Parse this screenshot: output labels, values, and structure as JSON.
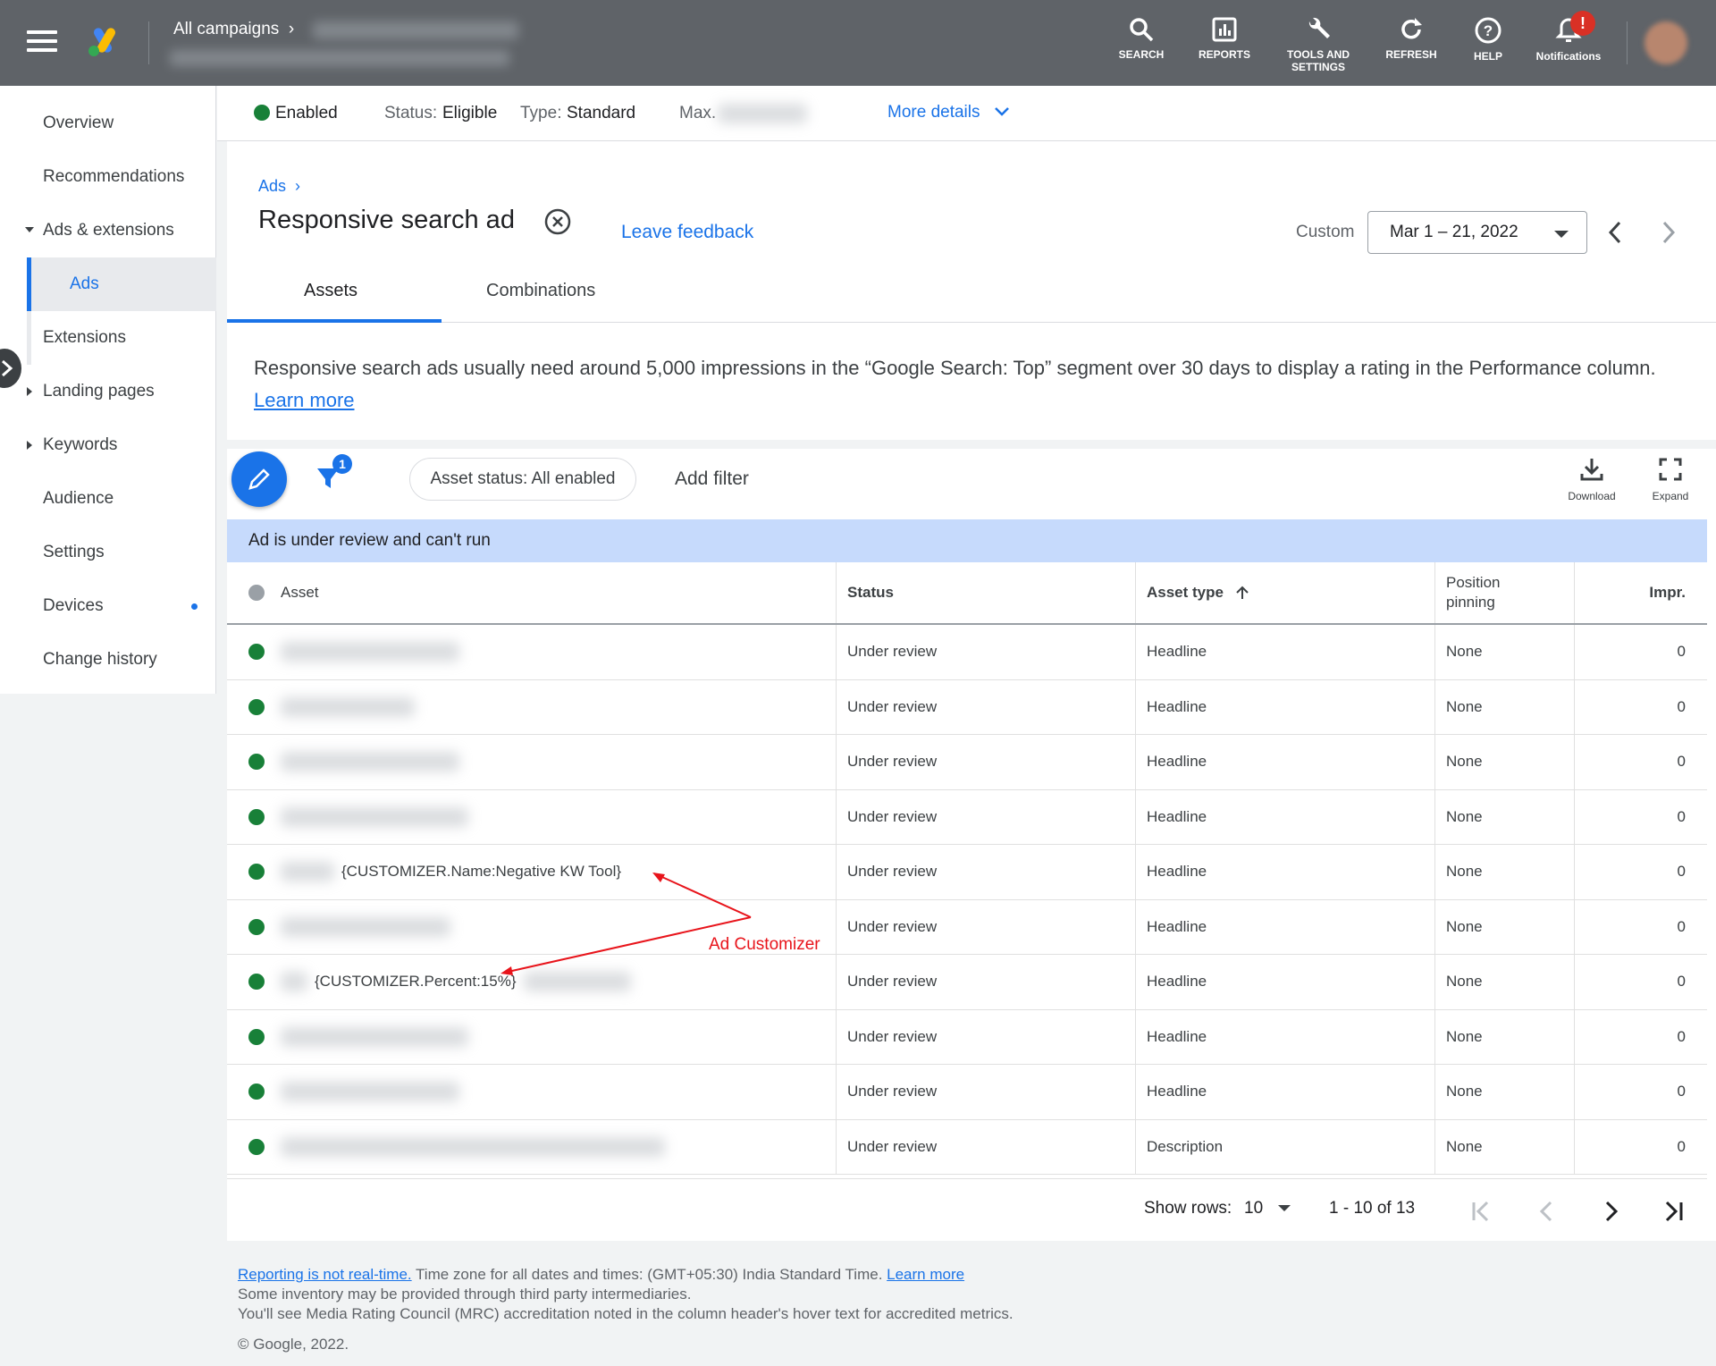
{
  "topbar": {
    "breadcrumb": "All campaigns",
    "items": [
      {
        "label": "SEARCH",
        "icon": "search-icon"
      },
      {
        "label": "REPORTS",
        "icon": "reports-icon"
      },
      {
        "label": "TOOLS AND SETTINGS",
        "icon": "wrench-icon"
      },
      {
        "label": "REFRESH",
        "icon": "refresh-icon"
      },
      {
        "label": "HELP",
        "icon": "help-icon"
      },
      {
        "label": "Notifications",
        "icon": "bell-icon"
      }
    ],
    "notification_badge": "!"
  },
  "sidebar": {
    "items": [
      {
        "label": "Overview"
      },
      {
        "label": "Recommendations"
      },
      {
        "label": "Ads & extensions"
      },
      {
        "label": "Ads"
      },
      {
        "label": "Extensions"
      },
      {
        "label": "Landing pages"
      },
      {
        "label": "Keywords"
      },
      {
        "label": "Audience"
      },
      {
        "label": "Settings"
      },
      {
        "label": "Devices"
      },
      {
        "label": "Change history"
      }
    ]
  },
  "statusbar": {
    "enabled": "Enabled",
    "status_label": "Status:",
    "status_value": "Eligible",
    "type_label": "Type:",
    "type_value": "Standard",
    "max_label": "Max.",
    "more_details": "More details"
  },
  "header": {
    "breadcrumb": "Ads",
    "title": "Responsive search ad",
    "feedback": "Leave feedback",
    "date_label": "Custom",
    "date_range": "Mar 1 – 21, 2022",
    "tabs": [
      "Assets",
      "Combinations"
    ]
  },
  "notice": {
    "text": "Responsive search ads usually need around 5,000 impressions in the “Google Search: Top” segment over 30 days to display a rating in the Performance column.",
    "link": "Learn more"
  },
  "toolbar": {
    "filter_count": "1",
    "chip": "Asset status: All enabled",
    "add_filter": "Add filter",
    "download": "Download",
    "expand": "Expand"
  },
  "review_bar": "Ad is under review and can't run",
  "table": {
    "columns": [
      "Asset",
      "Status",
      "Asset type",
      "Position pinning",
      "Impr."
    ],
    "rows": [
      {
        "asset": "",
        "status": "Under review",
        "type": "Headline",
        "pinning": "None",
        "impr": "0"
      },
      {
        "asset": "",
        "status": "Under review",
        "type": "Headline",
        "pinning": "None",
        "impr": "0"
      },
      {
        "asset": "",
        "status": "Under review",
        "type": "Headline",
        "pinning": "None",
        "impr": "0"
      },
      {
        "asset": "",
        "status": "Under review",
        "type": "Headline",
        "pinning": "None",
        "impr": "0"
      },
      {
        "asset": "{CUSTOMIZER.Name:Negative KW Tool}",
        "status": "Under review",
        "type": "Headline",
        "pinning": "None",
        "impr": "0"
      },
      {
        "asset": "",
        "status": "Under review",
        "type": "Headline",
        "pinning": "None",
        "impr": "0"
      },
      {
        "asset": "{CUSTOMIZER.Percent:15%}",
        "status": "Under review",
        "type": "Headline",
        "pinning": "None",
        "impr": "0"
      },
      {
        "asset": "",
        "status": "Under review",
        "type": "Headline",
        "pinning": "None",
        "impr": "0"
      },
      {
        "asset": "",
        "status": "Under review",
        "type": "Headline",
        "pinning": "None",
        "impr": "0"
      },
      {
        "asset": "",
        "status": "Under review",
        "type": "Description",
        "pinning": "None",
        "impr": "0"
      }
    ]
  },
  "annotation": "Ad Customizer",
  "pagination": {
    "show_rows_label": "Show rows:",
    "rows_value": "10",
    "range": "1 - 10 of 13"
  },
  "footer": {
    "link1": "Reporting is not real-time.",
    "text1": " Time zone for all dates and times: (GMT+05:30) India Standard Time. ",
    "link2": "Learn more",
    "line2": "Some inventory may be provided through third party intermediaries.",
    "line3": "You'll see Media Rating Council (MRC) accreditation noted in the column header's hover text for accredited metrics.",
    "copyright": "© Google, 2022."
  },
  "colors": {
    "accent": "#1a73e8",
    "topbar": "#5f6368",
    "status_green": "#188038",
    "annotation": "#e8141b"
  }
}
